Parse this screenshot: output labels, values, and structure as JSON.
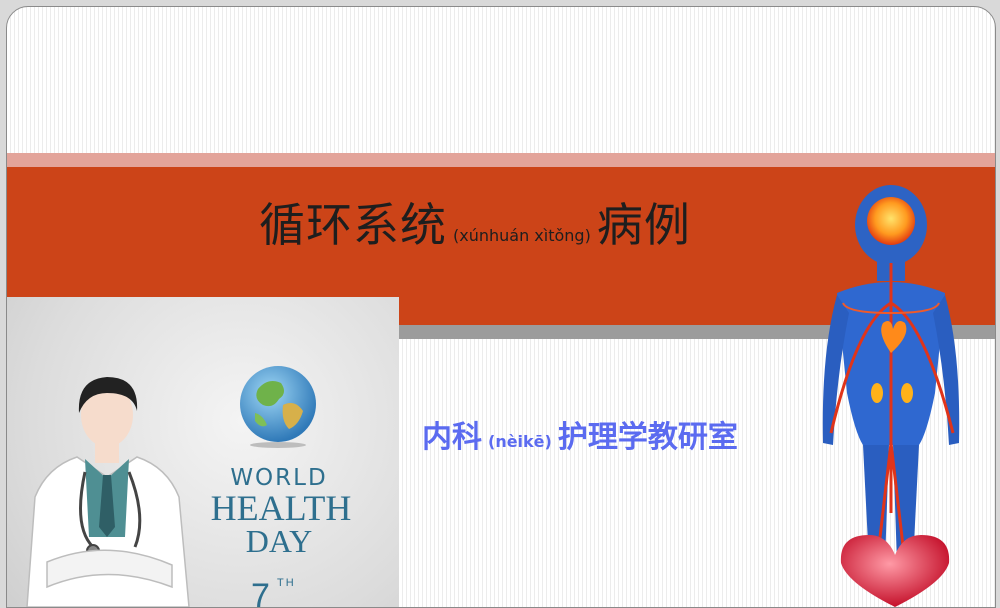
{
  "slide": {
    "title_zh_1": "循环系统",
    "title_pinyin": "(xúnhuán xìtǒng)",
    "title_zh_2": "病例",
    "subtitle_zh_1": "内科",
    "subtitle_pinyin": "(nèikē)",
    "subtitle_zh_2": "护理学教研室"
  },
  "poster": {
    "line1": "WORLD",
    "line2": "HEALTH",
    "line3": "DAY",
    "day_number": "7",
    "day_suffix": "TH"
  },
  "colors": {
    "title_band": "#cc4418",
    "title_band_top": "#e3a49a",
    "title_band_bottom": "#9c9c9c",
    "subtitle_text": "#5b6bf0",
    "poster_text": "#2e6f8e"
  }
}
